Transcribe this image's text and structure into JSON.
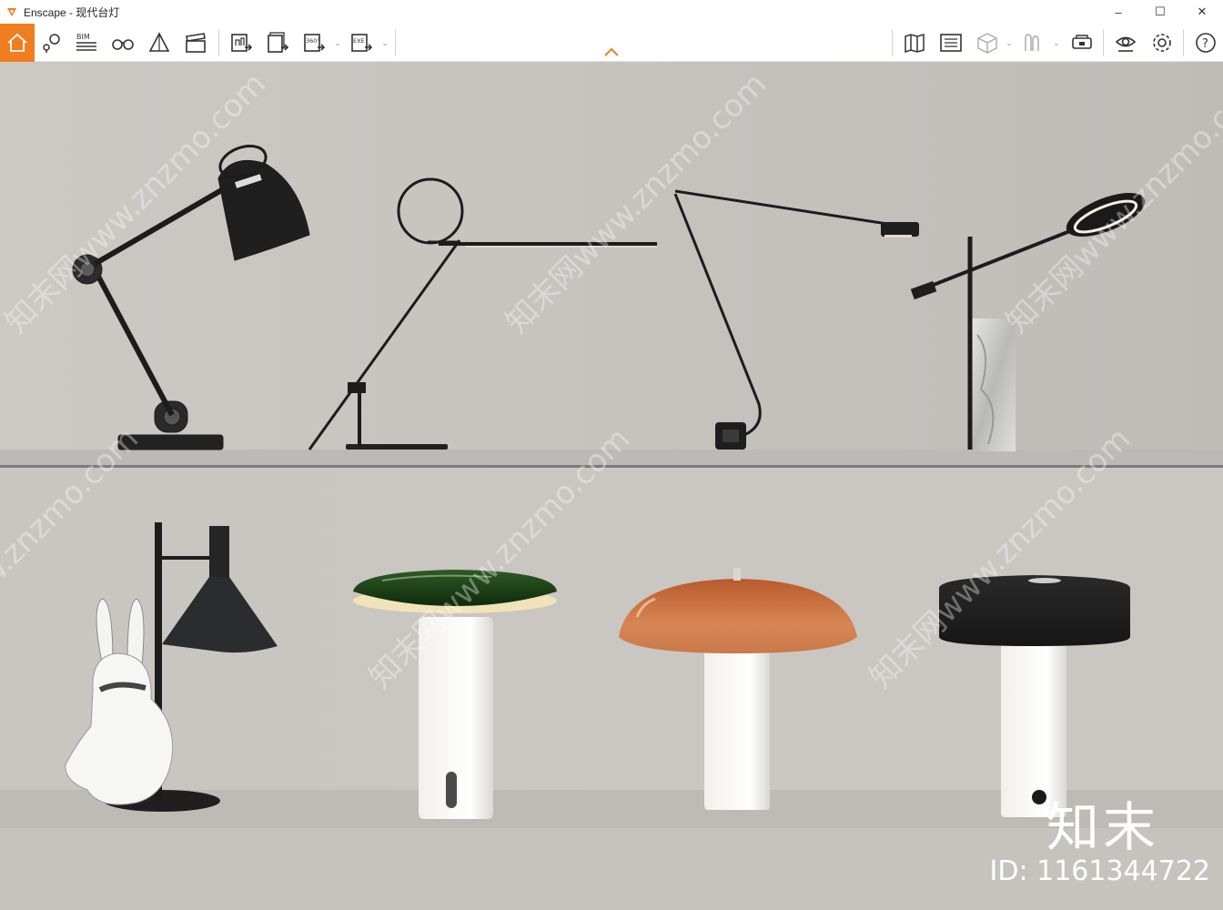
{
  "window": {
    "title": "Enscape - 现代台灯",
    "controls": [
      "–",
      "☐",
      "✕"
    ]
  },
  "toolbar": {
    "left_tools": [
      {
        "name": "home-icon"
      },
      {
        "name": "map-pin-icon"
      },
      {
        "name": "bim-icon",
        "label": "BIM"
      },
      {
        "name": "binoculars-icon"
      },
      {
        "name": "perspective-icon"
      },
      {
        "name": "clapper-icon"
      },
      {
        "name": "render-screenshot-icon"
      },
      {
        "name": "batch-render-icon"
      },
      {
        "name": "panorama-360-icon",
        "label": "360°"
      },
      {
        "name": "export-exe-icon",
        "label": "EXE"
      }
    ],
    "right_tools": [
      {
        "name": "map-icon"
      },
      {
        "name": "minimap-icon"
      },
      {
        "name": "cube-icon"
      },
      {
        "name": "asset-library-icon"
      },
      {
        "name": "vr-headset-icon"
      },
      {
        "name": "visual-settings-icon"
      },
      {
        "name": "settings-gear-icon"
      },
      {
        "name": "help-icon",
        "label": "?"
      }
    ],
    "accent": "#f07d1f"
  },
  "viewport": {
    "watermark": "知末网www.znzmo.com",
    "logo": "知末",
    "id_label": "ID: 1161344722"
  }
}
